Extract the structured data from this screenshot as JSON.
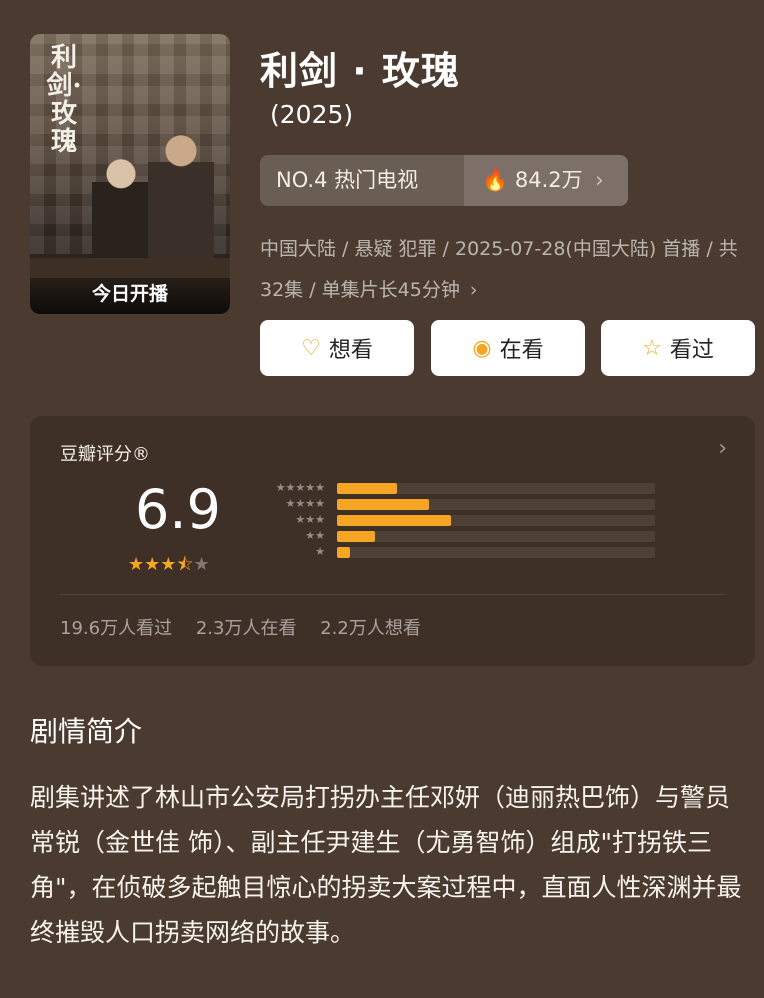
{
  "poster": {
    "title": "利剑·玫瑰",
    "badge": "今日开播"
  },
  "header": {
    "title": "利剑 · 玫瑰",
    "year": "(2025)"
  },
  "rank": {
    "label": "NO.4 热门电视",
    "heat_icon": "fire-icon",
    "heat": "84.2万",
    "chevron": "›"
  },
  "meta": {
    "line": "中国大陆 / 悬疑 犯罪 / 2025-07-28(中国大陆) 首播 / 共32集 / 单集片长45分钟",
    "chevron": "›"
  },
  "actions": [
    {
      "icon": "heart-plus-icon",
      "glyph": "♡",
      "label": "想看"
    },
    {
      "icon": "target-icon",
      "glyph": "◉",
      "label": "在看"
    },
    {
      "icon": "star-outline-icon",
      "glyph": "☆",
      "label": "看过"
    }
  ],
  "rating": {
    "label": "豆瓣评分®",
    "score": "6.9",
    "stars_value": 3.5,
    "distribution": [
      {
        "stars": "★★★★★",
        "fraction": 0.19
      },
      {
        "stars": "★★★★",
        "fraction": 0.29
      },
      {
        "stars": "★★★",
        "fraction": 0.36
      },
      {
        "stars": "★★",
        "fraction": 0.12
      },
      {
        "stars": "★",
        "fraction": 0.04
      }
    ],
    "stats": [
      "19.6万人看过",
      "2.3万人在看",
      "2.2万人想看"
    ]
  },
  "synopsis": {
    "title": "剧情简介",
    "text": "剧集讲述了林山市公安局打拐办主任邓妍（迪丽热巴饰）与警员常锐（金世佳 饰）、副主任尹建生（尤勇智饰）组成\"打拐铁三角\"，在侦破多起触目惊心的拐卖大案过程中，直面人性深渊并最终摧毁人口拐卖网络的故事。"
  },
  "colors": {
    "background": "#4a3a2f",
    "accent": "#f5a623"
  }
}
